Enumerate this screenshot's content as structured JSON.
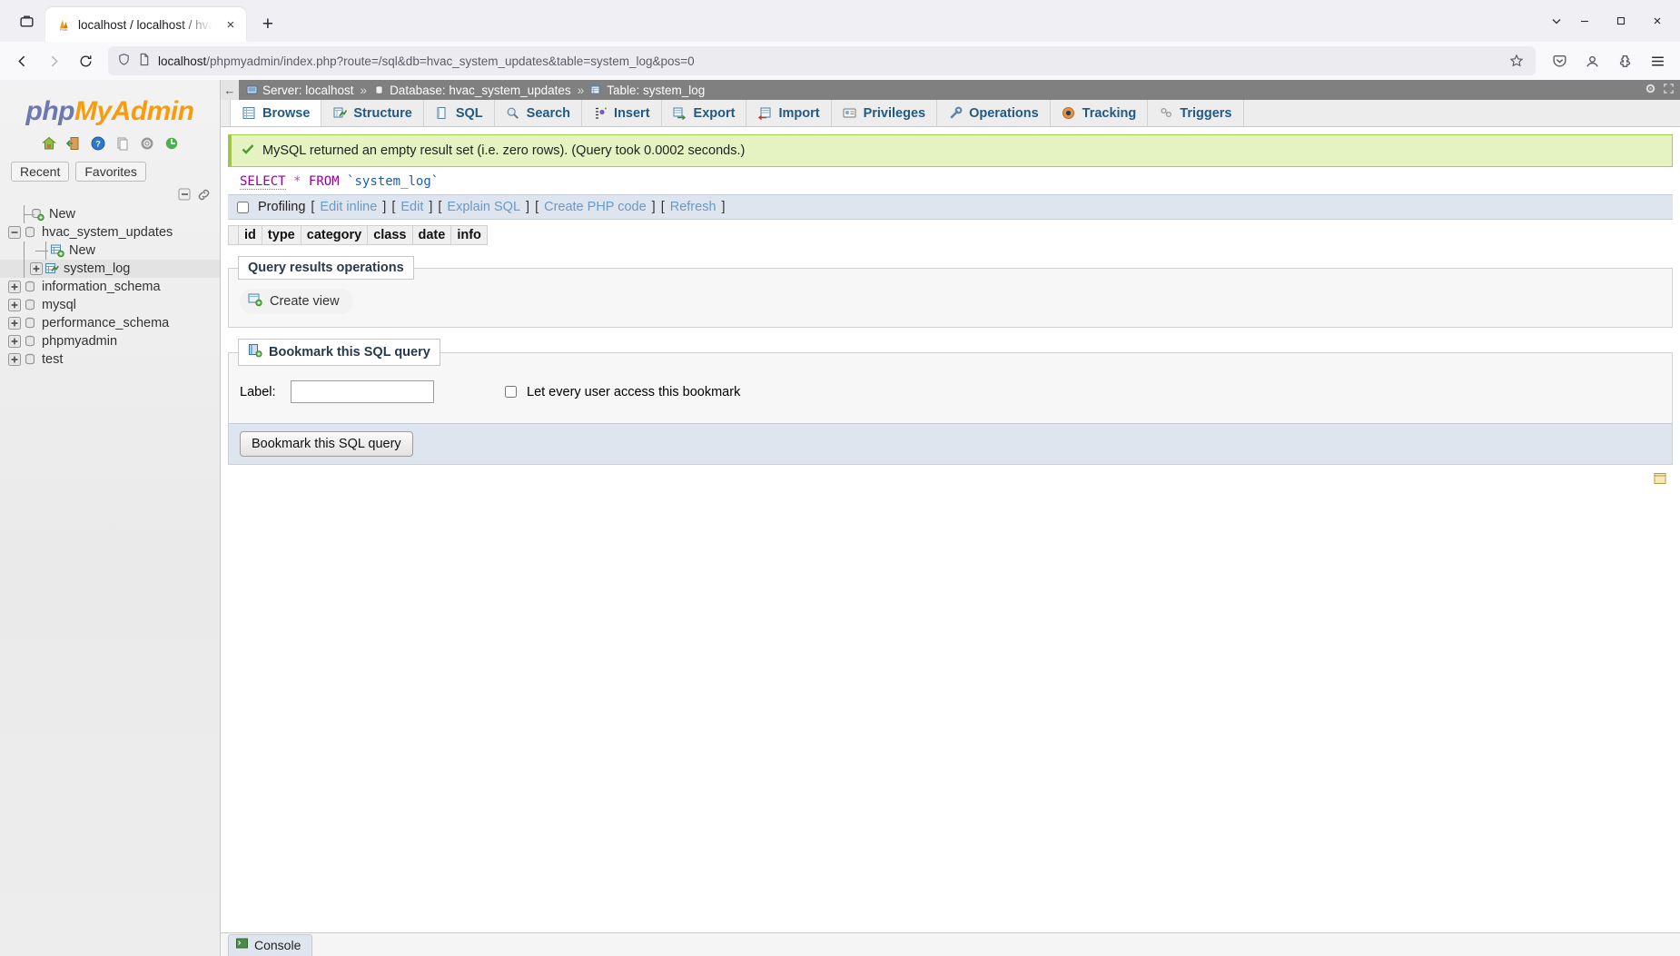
{
  "browser": {
    "tab": {
      "title": "localhost / localhost / hva",
      "favicon": "phpmyadmin-icon",
      "close": "×"
    },
    "newtab_label": "+",
    "url_host": "localhost",
    "url_path": "/phpmyadmin/index.php?route=/sql&db=hvac_system_updates&table=system_log&pos=0",
    "window_controls": {
      "minimize": "—",
      "maximize": "□",
      "close": "✕"
    },
    "toolbar_icons": [
      "shield-icon",
      "page-icon",
      "bookmark-star-icon",
      "pocket-icon",
      "account-icon",
      "extensions-icon",
      "app-menu-icon"
    ]
  },
  "sidebar": {
    "logo": {
      "php": "php",
      "my": "My",
      "admin": "Admin"
    },
    "icons": [
      "home-icon",
      "logout-icon",
      "help-icon",
      "docs-icon",
      "settings-icon",
      "reload-icon"
    ],
    "tabs": [
      {
        "label": "Recent"
      },
      {
        "label": "Favorites"
      }
    ],
    "tree_controls": [
      "collapse-all-icon",
      "link-icon"
    ],
    "tree": [
      {
        "label": "New",
        "icon": "new-database-icon",
        "depth": 0,
        "toggle": "none",
        "selected": false
      },
      {
        "label": "hvac_system_updates",
        "icon": "database-icon",
        "depth": 0,
        "toggle": "minus",
        "selected": false
      },
      {
        "label": "New",
        "icon": "new-table-icon",
        "depth": 1,
        "toggle": "none",
        "selected": false
      },
      {
        "label": "system_log",
        "icon": "table-icon",
        "depth": 1,
        "toggle": "plus",
        "selected": true
      },
      {
        "label": "information_schema",
        "icon": "database-icon",
        "depth": 0,
        "toggle": "plus",
        "selected": false
      },
      {
        "label": "mysql",
        "icon": "database-icon",
        "depth": 0,
        "toggle": "plus",
        "selected": false
      },
      {
        "label": "performance_schema",
        "icon": "database-icon",
        "depth": 0,
        "toggle": "plus",
        "selected": false
      },
      {
        "label": "phpmyadmin",
        "icon": "database-icon",
        "depth": 0,
        "toggle": "plus",
        "selected": false
      },
      {
        "label": "test",
        "icon": "database-icon",
        "depth": 0,
        "toggle": "plus",
        "selected": false
      }
    ]
  },
  "breadcrumb": {
    "back": "←",
    "server": "Server: localhost",
    "database": "Database: hvac_system_updates",
    "table": "Table: system_log",
    "separator": "»"
  },
  "tabs": [
    {
      "label": "Browse",
      "icon": "browse-icon",
      "active": true
    },
    {
      "label": "Structure",
      "icon": "structure-icon",
      "active": false
    },
    {
      "label": "SQL",
      "icon": "sql-icon",
      "active": false
    },
    {
      "label": "Search",
      "icon": "search-icon",
      "active": false
    },
    {
      "label": "Insert",
      "icon": "insert-icon",
      "active": false
    },
    {
      "label": "Export",
      "icon": "export-icon",
      "active": false
    },
    {
      "label": "Import",
      "icon": "import-icon",
      "active": false
    },
    {
      "label": "Privileges",
      "icon": "privileges-icon",
      "active": false
    },
    {
      "label": "Operations",
      "icon": "operations-icon",
      "active": false
    },
    {
      "label": "Tracking",
      "icon": "tracking-icon",
      "active": false
    },
    {
      "label": "Triggers",
      "icon": "triggers-icon",
      "active": false
    }
  ],
  "result": {
    "message": "MySQL returned an empty result set (i.e. zero rows). (Query took 0.0002 seconds.)",
    "check_icon": "check-icon",
    "sql": {
      "keyword1": "SELECT",
      "star": "*",
      "keyword2": "FROM",
      "table": "`system_log`"
    },
    "profiling": {
      "label": "Profiling",
      "links": [
        "Edit inline",
        "Edit",
        "Explain SQL",
        "Create PHP code",
        "Refresh"
      ],
      "open_bracket": "[",
      "close_bracket": "]"
    },
    "columns": [
      "id",
      "type",
      "category",
      "class",
      "date",
      "info"
    ]
  },
  "query_results_operations": {
    "legend": "Query results operations",
    "create_view": {
      "label": "Create view",
      "icon": "create-view-icon"
    }
  },
  "bookmark": {
    "legend": "Bookmark this SQL query",
    "legend_icon": "bookmark-icon",
    "label_text": "Label:",
    "input_value": "",
    "checkbox_label": "Let every user access this bookmark",
    "submit_label": "Bookmark this SQL query"
  },
  "console": {
    "label": "Console",
    "icon": "console-icon"
  },
  "colors": {
    "accent_blue": "#235a81",
    "success_bg": "#e5f2c1",
    "success_border": "#a6cd4a",
    "breadcrumb_bg": "#808080",
    "panel_blue": "#dfe5ef",
    "logo_orange": "#f89c0e",
    "logo_blue": "#6c78af"
  }
}
